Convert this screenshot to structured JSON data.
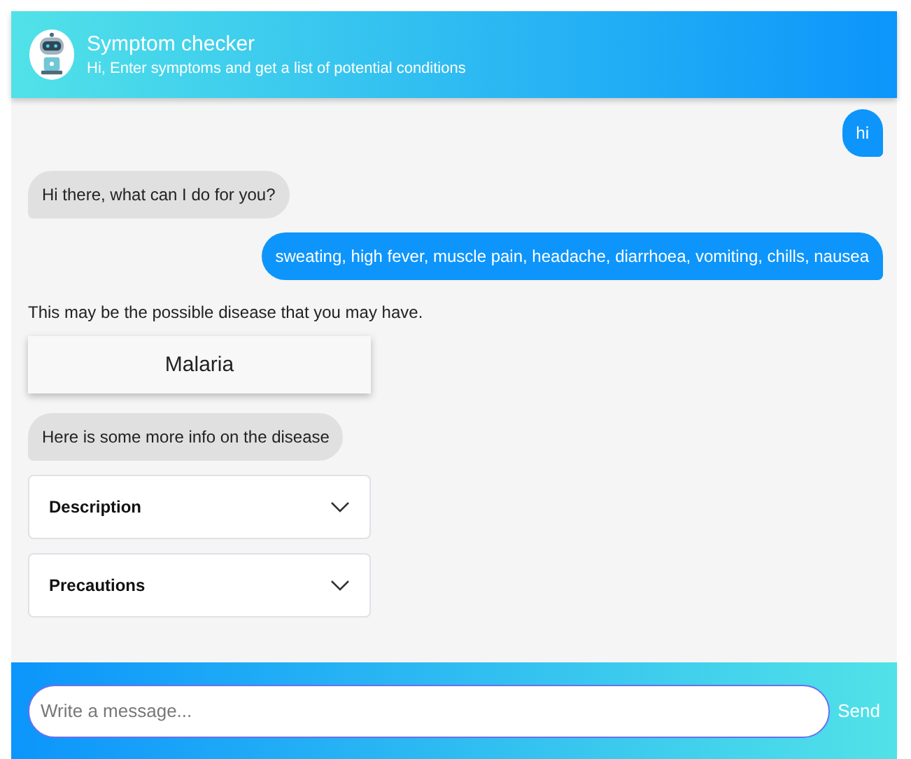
{
  "header": {
    "title": "Symptom checker",
    "subtitle": "Hi, Enter symptoms and get a list of potential conditions"
  },
  "messages": [
    {
      "kind": "user",
      "text": "hi"
    },
    {
      "kind": "bot",
      "text": "Hi there, what can I do for you?"
    },
    {
      "kind": "user",
      "text": "sweating, high fever, muscle pain, headache, diarrhoea, vomiting, chills, nausea"
    },
    {
      "kind": "text",
      "text": "This may be the possible disease that you may have."
    },
    {
      "kind": "disease",
      "text": "Malaria"
    },
    {
      "kind": "bot",
      "text": "Here is some more info on the disease"
    },
    {
      "kind": "accordion",
      "text": "Description",
      "expanded": false
    },
    {
      "kind": "accordion",
      "text": "Precautions",
      "expanded": false
    }
  ],
  "composer": {
    "placeholder": "Write a message...",
    "send": "Send"
  }
}
